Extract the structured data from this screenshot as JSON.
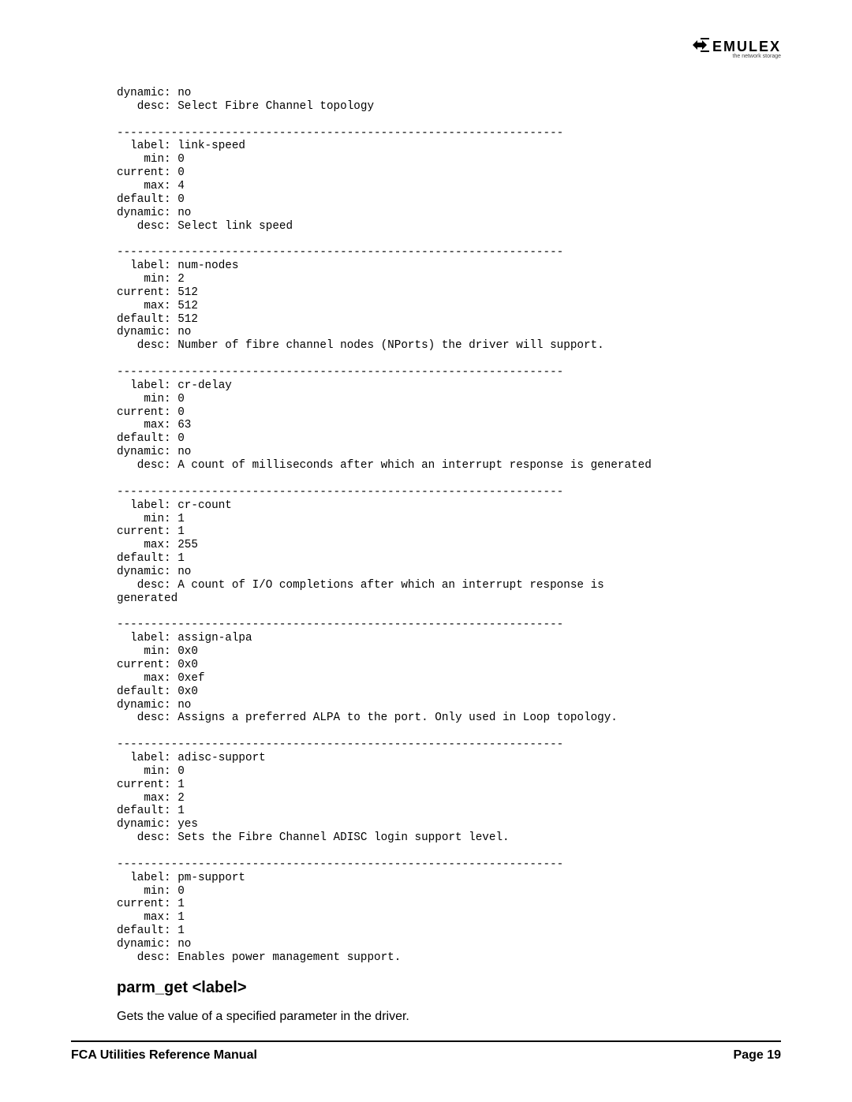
{
  "logo": {
    "brand": "EMULEX",
    "tag": "the network storage"
  },
  "divider": "------------------------------------------------------------------",
  "params": [
    {
      "partial": true,
      "dynamic": "no",
      "desc": "Select Fibre Channel topology"
    },
    {
      "label": "link-speed",
      "min": "0",
      "current": "0",
      "max": "4",
      "default": "0",
      "dynamic": "no",
      "desc": "Select link speed"
    },
    {
      "label": "num-nodes",
      "min": "2",
      "current": "512",
      "max": "512",
      "default": "512",
      "dynamic": "no",
      "desc": "Number of fibre channel nodes (NPorts) the driver will support."
    },
    {
      "label": "cr-delay",
      "min": "0",
      "current": "0",
      "max": "63",
      "default": "0",
      "dynamic": "no",
      "desc": "A count of milliseconds after which an interrupt response is generated"
    },
    {
      "label": "cr-count",
      "min": "1",
      "current": "1",
      "max": "255",
      "default": "1",
      "dynamic": "no",
      "desc": "A count of I/O completions after which an interrupt response is",
      "desc2": "generated"
    },
    {
      "label": "assign-alpa",
      "min": "0x0",
      "current": "0x0",
      "max": "0xef",
      "default": "0x0",
      "dynamic": "no",
      "desc": "Assigns a preferred ALPA to the port. Only used in Loop topology."
    },
    {
      "label": "adisc-support",
      "min": "0",
      "current": "1",
      "max": "2",
      "default": "1",
      "dynamic": "yes",
      "desc": "Sets the Fibre Channel ADISC login support level."
    },
    {
      "label": "pm-support",
      "min": "0",
      "current": "1",
      "max": "1",
      "default": "1",
      "dynamic": "no",
      "desc": "Enables power management support."
    }
  ],
  "section": {
    "heading": "parm_get <label>",
    "body": "Gets the value of a specified parameter in the driver."
  },
  "footer": {
    "left": "FCA Utilities Reference Manual",
    "right": "Page 19"
  }
}
